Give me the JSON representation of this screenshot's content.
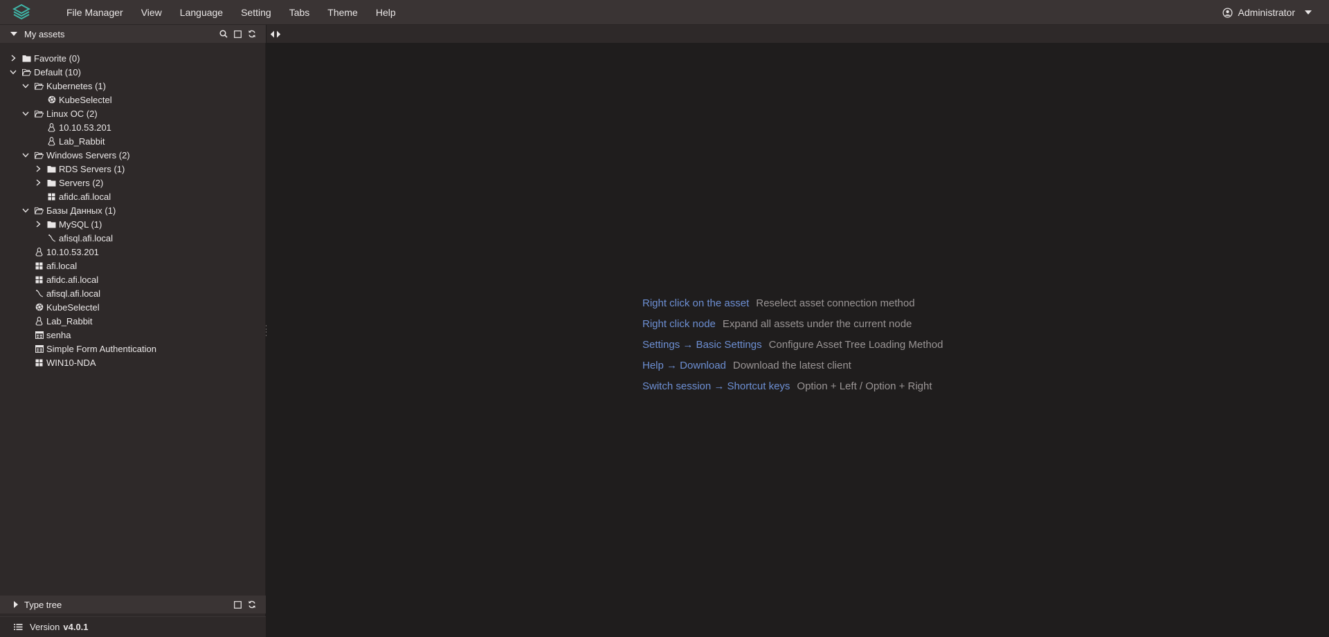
{
  "menu": {
    "items": [
      "File Manager",
      "View",
      "Language",
      "Setting",
      "Tabs",
      "Theme",
      "Help"
    ],
    "user": "Administrator"
  },
  "sidebar": {
    "title": "My assets",
    "tree": [
      {
        "label": "Favorite (0)",
        "level": 0,
        "type": "folder",
        "expanded": false,
        "has_children": true
      },
      {
        "label": "Default (10)",
        "level": 0,
        "type": "folder-open",
        "expanded": true,
        "has_children": true
      },
      {
        "label": "Kubernetes (1)",
        "level": 1,
        "type": "folder-open",
        "expanded": true,
        "has_children": true
      },
      {
        "label": "KubeSelectel",
        "level": 2,
        "type": "kubernetes",
        "has_children": false
      },
      {
        "label": "Linux OC (2)",
        "level": 1,
        "type": "folder-open",
        "expanded": true,
        "has_children": true
      },
      {
        "label": "10.10.53.201",
        "level": 2,
        "type": "linux",
        "has_children": false
      },
      {
        "label": "Lab_Rabbit",
        "level": 2,
        "type": "linux",
        "has_children": false
      },
      {
        "label": "Windows Servers (2)",
        "level": 1,
        "type": "folder-open",
        "expanded": true,
        "has_children": true
      },
      {
        "label": "RDS Servers (1)",
        "level": 2,
        "type": "folder",
        "expanded": false,
        "has_children": true
      },
      {
        "label": "Servers (2)",
        "level": 2,
        "type": "folder",
        "expanded": false,
        "has_children": true
      },
      {
        "label": "afidc.afi.local",
        "level": 2,
        "type": "windows",
        "has_children": false
      },
      {
        "label": "Базы Данных (1)",
        "level": 1,
        "type": "folder-open",
        "expanded": true,
        "has_children": true
      },
      {
        "label": "MySQL (1)",
        "level": 2,
        "type": "folder",
        "expanded": false,
        "has_children": true
      },
      {
        "label": "afisql.afi.local",
        "level": 2,
        "type": "database",
        "has_children": false
      },
      {
        "label": "10.10.53.201",
        "level": 1,
        "type": "linux",
        "has_children": false
      },
      {
        "label": "afi.local",
        "level": 1,
        "type": "windows",
        "has_children": false
      },
      {
        "label": "afidc.afi.local",
        "level": 1,
        "type": "windows",
        "has_children": false
      },
      {
        "label": "afisql.afi.local",
        "level": 1,
        "type": "database",
        "has_children": false
      },
      {
        "label": "KubeSelectel",
        "level": 1,
        "type": "kubernetes",
        "has_children": false
      },
      {
        "label": "Lab_Rabbit",
        "level": 1,
        "type": "linux",
        "has_children": false
      },
      {
        "label": "senha",
        "level": 1,
        "type": "web",
        "has_children": false
      },
      {
        "label": "Simple Form Authentication",
        "level": 1,
        "type": "web",
        "has_children": false
      },
      {
        "label": "WIN10-NDA",
        "level": 1,
        "type": "windows",
        "has_children": false
      }
    ],
    "type_tree_title": "Type tree",
    "version_label": "Version",
    "version_value": "v4.0.1"
  },
  "hints": [
    {
      "key": "Right click on the asset",
      "value": "Reselect asset connection method"
    },
    {
      "key": "Right click node",
      "value": "Expand all assets under the current node"
    },
    {
      "key": "Settings → Basic Settings",
      "value": "Configure Asset Tree Loading Method"
    },
    {
      "key": "Help → Download",
      "value": "Download the latest client"
    },
    {
      "key": "Switch session → Shortcut keys",
      "value": "Option + Left / Option + Right"
    }
  ],
  "colors": {
    "accent": "#6d8fd3",
    "logo": "#3fb6a8"
  }
}
